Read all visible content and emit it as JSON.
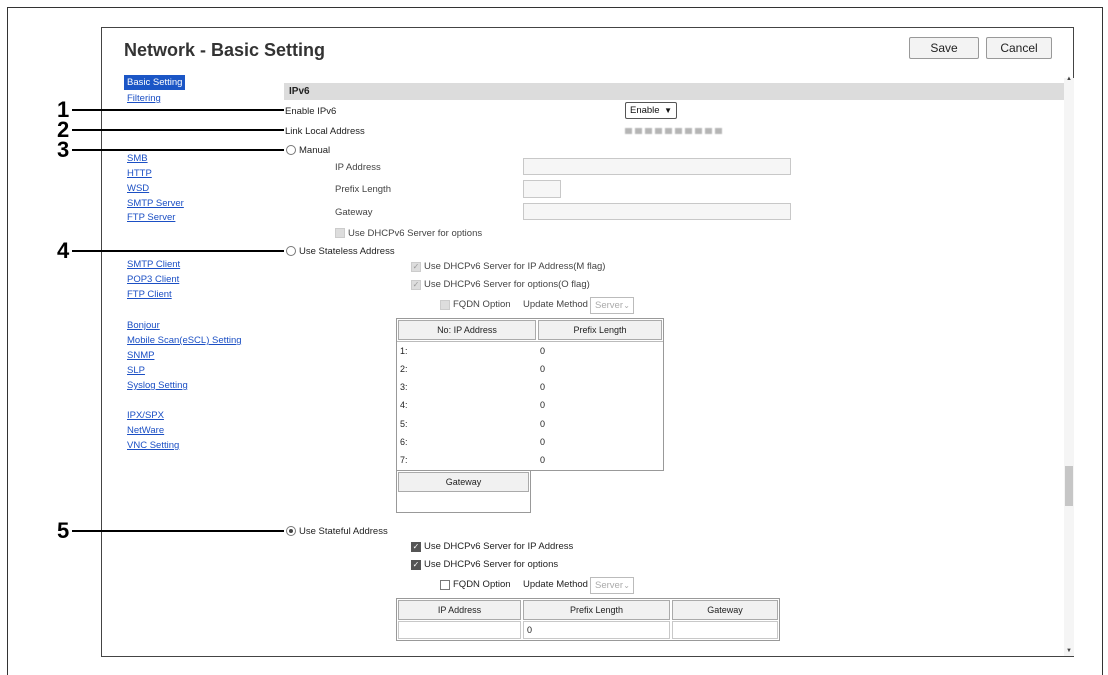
{
  "page_title": "Network - Basic Setting",
  "buttons": {
    "save": "Save",
    "cancel": "Cancel"
  },
  "nav": {
    "active": "Basic Setting",
    "items": [
      "Filtering",
      "SMB",
      "HTTP",
      "WSD",
      "SMTP Server",
      "FTP Server",
      "SMTP Client",
      "POP3 Client",
      "FTP Client",
      "Bonjour",
      "Mobile Scan(eSCL) Setting",
      "SNMP",
      "SLP",
      "Syslog Setting",
      "IPX/SPX",
      "NetWare",
      "VNC Setting"
    ]
  },
  "section": "IPv6",
  "enable_ipv6": {
    "label": "Enable IPv6",
    "value": "Enable"
  },
  "link_local": {
    "label": "Link Local Address"
  },
  "manual": {
    "label": "Manual",
    "ip_address": "IP Address",
    "prefix_length": "Prefix Length",
    "gateway": "Gateway",
    "dhcp_options": "Use DHCPv6 Server for options"
  },
  "stateless": {
    "label": "Use Stateless Address",
    "m_flag": "Use DHCPv6 Server for IP Address(M flag)",
    "o_flag": "Use DHCPv6 Server for options(O flag)",
    "fqdn": "FQDN Option",
    "update_method": "Update Method",
    "update_value": "Server",
    "col_ip": "No: IP Address",
    "col_prefix": "Prefix Length",
    "rows": [
      {
        "no": "1:",
        "prefix": "0"
      },
      {
        "no": "2:",
        "prefix": "0"
      },
      {
        "no": "3:",
        "prefix": "0"
      },
      {
        "no": "4:",
        "prefix": "0"
      },
      {
        "no": "5:",
        "prefix": "0"
      },
      {
        "no": "6:",
        "prefix": "0"
      },
      {
        "no": "7:",
        "prefix": "0"
      }
    ],
    "gateway_header": "Gateway"
  },
  "stateful": {
    "label": "Use Stateful Address",
    "ip": "Use DHCPv6 Server for IP Address",
    "options": "Use DHCPv6 Server for options",
    "fqdn": "FQDN Option",
    "update_method": "Update Method",
    "update_value": "Server",
    "col_ip": "IP Address",
    "col_prefix": "Prefix Length",
    "col_gateway": "Gateway",
    "prefix_value": "0"
  },
  "callouts": [
    "1",
    "2",
    "3",
    "4",
    "5"
  ],
  "colors": {
    "nav_link": "#1b4fc4",
    "nav_active_bg": "#1b56c6",
    "section_bg": "#dcdcdc"
  }
}
